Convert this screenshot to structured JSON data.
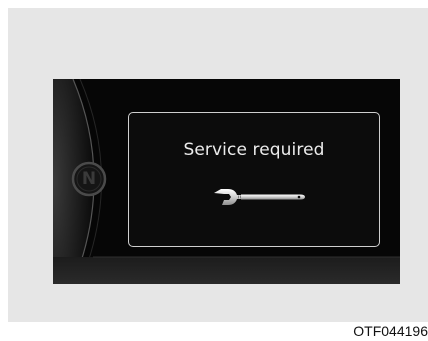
{
  "display": {
    "message": "Service required",
    "gear_indicator": "N",
    "message_icon": "wrench-icon"
  },
  "figure": {
    "code": "OTF044196"
  },
  "colors": {
    "panel_background": "#e6e6e6",
    "display_background": "#060606",
    "message_text": "#ececec",
    "window_border": "#cfcfcf"
  }
}
